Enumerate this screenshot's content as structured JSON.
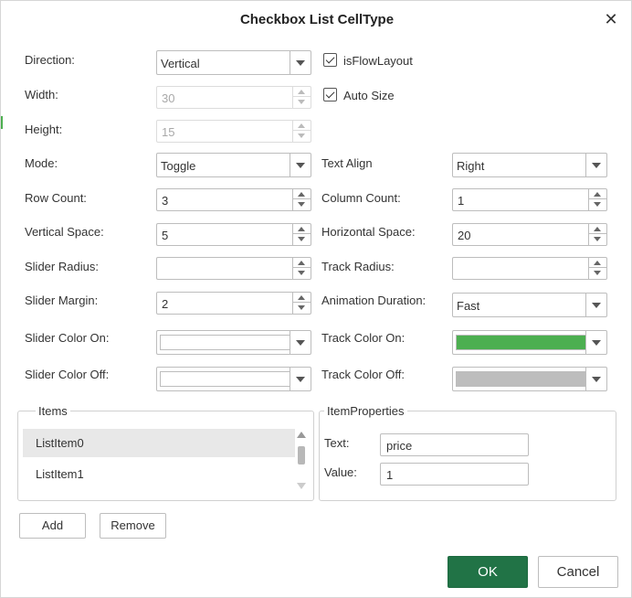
{
  "dialog": {
    "title": "Checkbox List CellType",
    "close_glyph": "✕"
  },
  "fields": {
    "direction": {
      "label": "Direction:",
      "value": "Vertical"
    },
    "width": {
      "label": "Width:",
      "value": "30"
    },
    "height": {
      "label": "Height:",
      "value": "15"
    },
    "mode": {
      "label": "Mode:",
      "value": "Toggle"
    },
    "row_count": {
      "label": "Row Count:",
      "value": "3"
    },
    "vertical_space": {
      "label": "Vertical Space:",
      "value": "5"
    },
    "slider_radius": {
      "label": "Slider Radius:",
      "value": ""
    },
    "slider_margin": {
      "label": "Slider Margin:",
      "value": "2"
    },
    "slider_color_on": {
      "label": "Slider Color On:",
      "color": "#ffffff"
    },
    "slider_color_off": {
      "label": "Slider Color Off:",
      "color": "#ffffff"
    },
    "is_flow_layout": {
      "label": "isFlowLayout",
      "checked": true
    },
    "auto_size": {
      "label": "Auto Size",
      "checked": true
    },
    "text_align": {
      "label": "Text Align",
      "value": "Right"
    },
    "column_count": {
      "label": "Column Count:",
      "value": "1"
    },
    "horizontal_space": {
      "label": "Horizontal Space:",
      "value": "20"
    },
    "track_radius": {
      "label": "Track Radius:",
      "value": ""
    },
    "animation_duration": {
      "label": "Animation Duration:",
      "value": "Fast"
    },
    "track_color_on": {
      "label": "Track Color On:",
      "color": "#4caf50"
    },
    "track_color_off": {
      "label": "Track Color Off:",
      "color": "#bdbdbd"
    }
  },
  "items": {
    "title": "Items",
    "list": [
      "ListItem0",
      "ListItem1"
    ],
    "selected_index": 0
  },
  "item_properties": {
    "title": "ItemProperties",
    "text_label": "Text:",
    "text_value": "price",
    "value_label": "Value:",
    "value_value": "1"
  },
  "buttons": {
    "add": "Add",
    "remove": "Remove",
    "ok": "OK",
    "cancel": "Cancel"
  }
}
